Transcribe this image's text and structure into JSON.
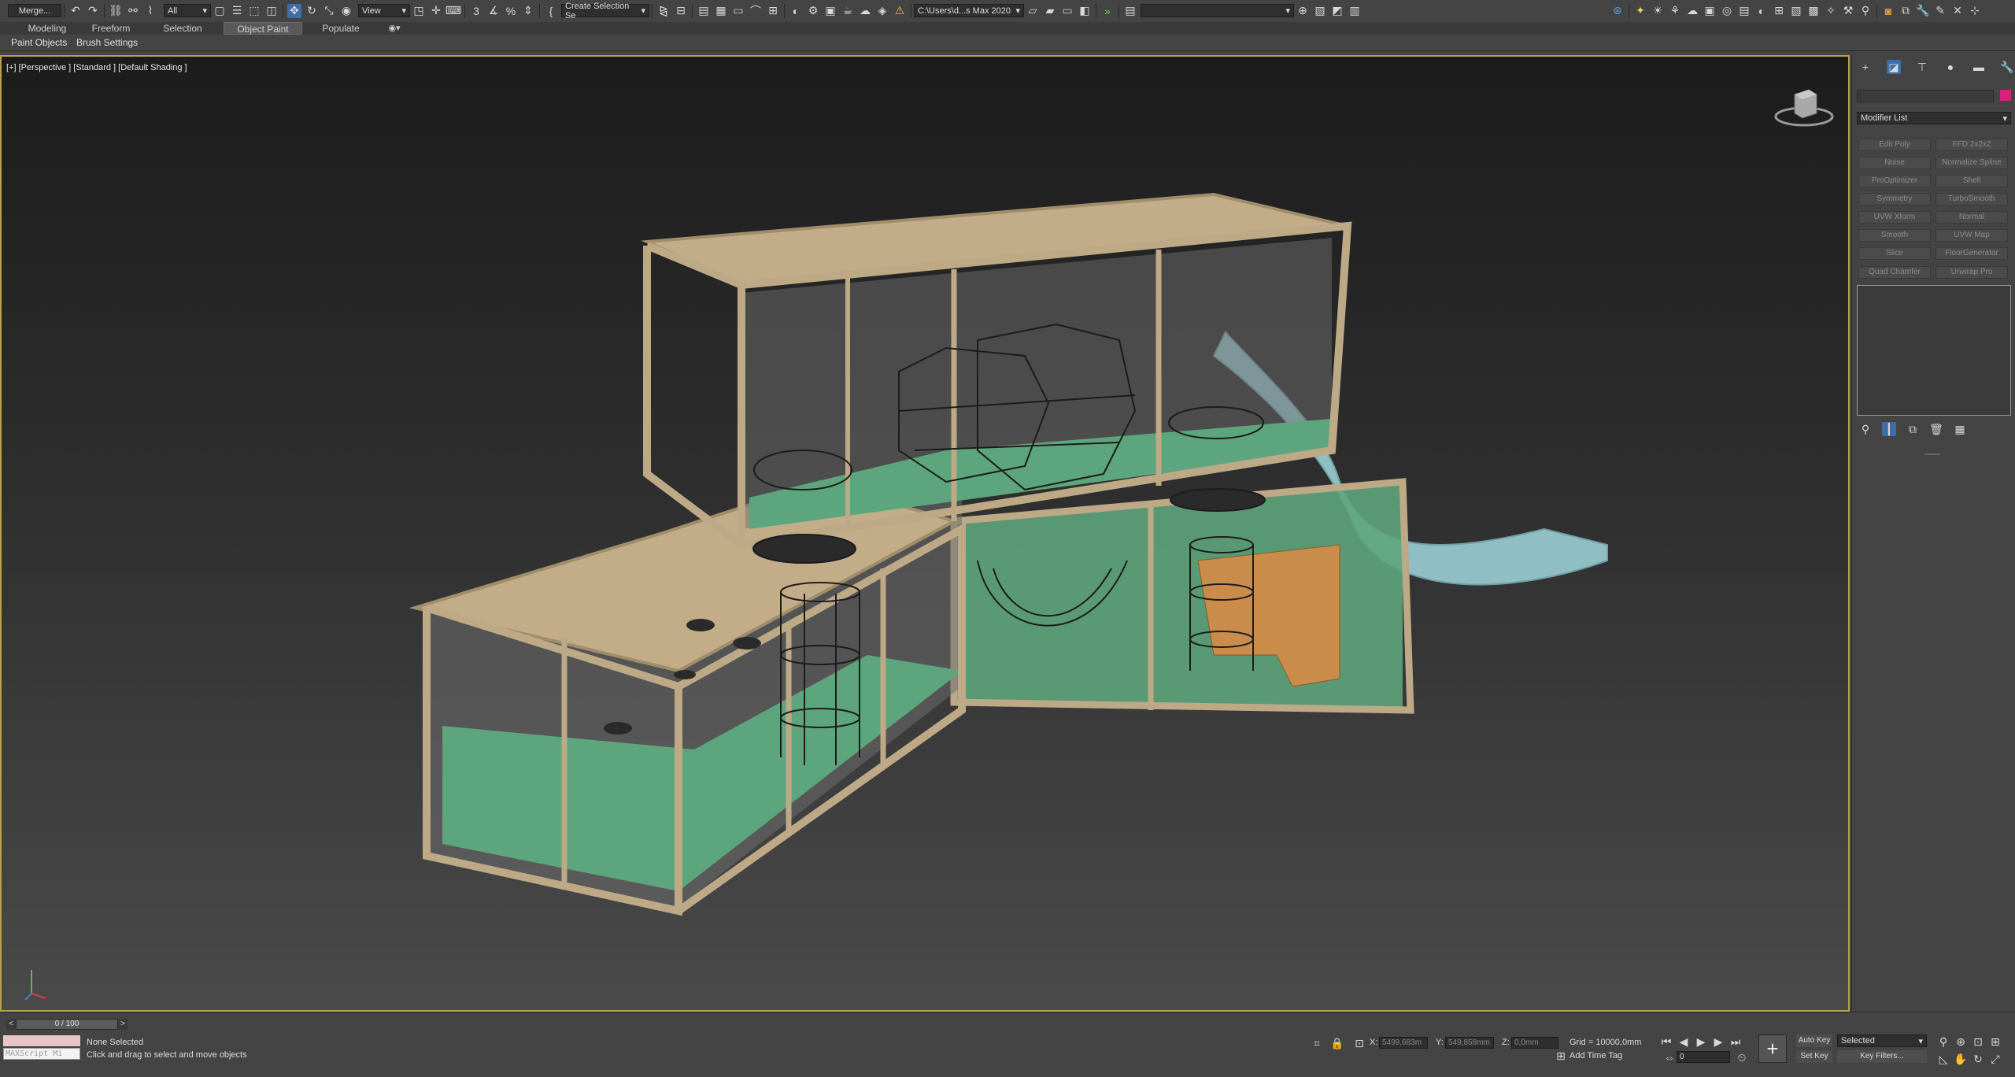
{
  "toolbar": {
    "merge_label": "Merge...",
    "filter_value": "All",
    "ref_coord_value": "View",
    "named_selection_value": "Create Selection Se",
    "project_path": "C:\\Users\\d...s Max 2020"
  },
  "ribbon": {
    "tabs": [
      "Modeling",
      "Freeform",
      "Selection",
      "Object Paint",
      "Populate"
    ],
    "active_tab": "Object Paint",
    "subtabs": [
      "Paint Objects",
      "Brush Settings"
    ]
  },
  "viewport": {
    "label": "[+] [Perspective ] [Standard ] [Default Shading ]"
  },
  "command_panel": {
    "modifier_list_label": "Modifier List",
    "modifier_buttons": [
      [
        "Edit Poly",
        "FFD 2x2x2"
      ],
      [
        "Noise",
        "Normalize Spline"
      ],
      [
        "ProOptimizer",
        "Shell"
      ],
      [
        "Symmetry",
        "TurboSmooth"
      ],
      [
        "UVW Xform",
        "Normal"
      ],
      [
        "Smooth",
        "UVW Map"
      ],
      [
        "Slice",
        "FloorGenerator"
      ],
      [
        "Quad Chamfer",
        "Unwrap Pro"
      ]
    ]
  },
  "timeline": {
    "frame_counter": "0 / 100"
  },
  "status": {
    "maxscript_label": "MAXScript Mi",
    "selection_status": "None Selected",
    "prompt": "Click and drag to select and move objects",
    "x_label": "X:",
    "x_value": "5499,683m",
    "y_label": "Y:",
    "y_value": "549,858mm",
    "z_label": "Z:",
    "z_value": "0,0mm",
    "grid": "Grid = 10000,0mm",
    "add_time_tag": "Add Time Tag",
    "auto_key": "Auto Key",
    "key_mode_value": "Selected",
    "set_key": "Set Key",
    "key_filters": "Key Filters...",
    "current_frame": "0"
  },
  "colors": {
    "viewport_border": "#b8a24a",
    "wood_frame": "#bda986",
    "floor_green": "#5da57c",
    "slide_blue": "#8fbfc4",
    "ramp_orange": "#c98c4a"
  }
}
